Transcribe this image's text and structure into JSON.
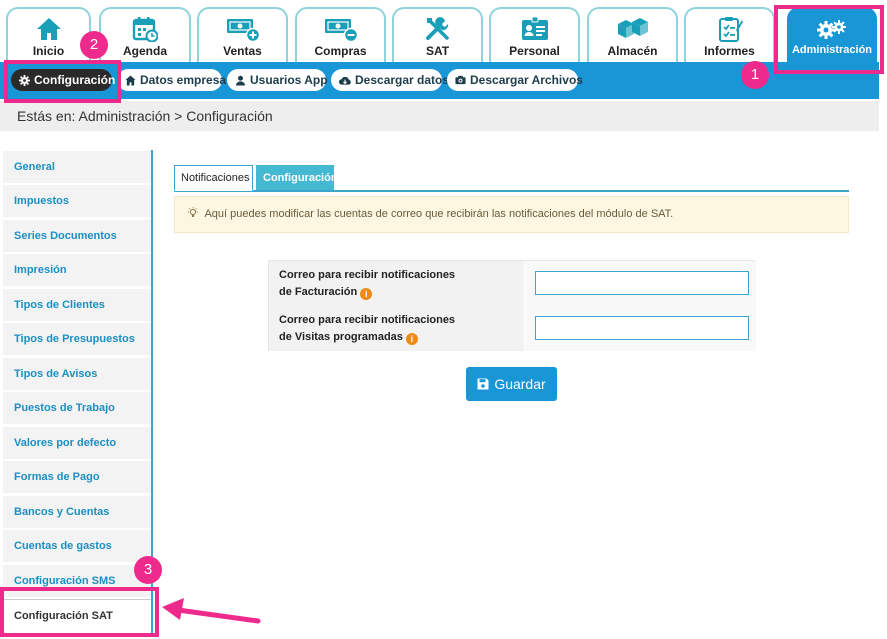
{
  "top_tabs": [
    {
      "label": "Inicio",
      "icon": "home-icon"
    },
    {
      "label": "Agenda",
      "icon": "calendar-icon"
    },
    {
      "label": "Ventas",
      "icon": "money-plus-icon"
    },
    {
      "label": "Compras",
      "icon": "money-minus-icon"
    },
    {
      "label": "SAT",
      "icon": "tools-icon"
    },
    {
      "label": "Personal",
      "icon": "id-card-icon"
    },
    {
      "label": "Almacén",
      "icon": "boxes-icon"
    },
    {
      "label": "Informes",
      "icon": "clipboard-icon"
    },
    {
      "label": "Administración",
      "icon": "gears-icon"
    }
  ],
  "sub_nav": [
    {
      "label": "Configuración",
      "icon": "gear-icon"
    },
    {
      "label": "Datos empresa",
      "icon": "home-icon"
    },
    {
      "label": "Usuarios App",
      "icon": "user-icon"
    },
    {
      "label": "Descargar datos",
      "icon": "cloud-download-icon"
    },
    {
      "label": "Descargar Archivos",
      "icon": "camera-icon"
    }
  ],
  "breadcrumb": "Estás en: Administración > Configuración",
  "sidebar": [
    "General",
    "Impuestos",
    "Series Documentos",
    "Impresión",
    "Tipos de Clientes",
    "Tipos de Presupuestos",
    "Tipos de Avisos",
    "Puestos de Trabajo",
    "Valores por defecto",
    "Formas de Pago",
    "Bancos y Cuentas",
    "Cuentas de gastos",
    "Configuración SMS",
    "Configuración SAT"
  ],
  "content_tabs": [
    "Notificaciones",
    "Configuración"
  ],
  "notice": "Aquí puedes modificar las cuentas de correo que recibirán las notificaciones del módulo de SAT.",
  "form": {
    "rows": [
      {
        "line1": "Correo para recibir notificaciones",
        "line2": "de Facturación",
        "value": ""
      },
      {
        "line1": "Correo para recibir notificaciones",
        "line2": "de Visitas programadas",
        "value": ""
      }
    ],
    "info_glyph": "i"
  },
  "save_label": "Guardar",
  "annotations": [
    "1",
    "2",
    "3"
  ],
  "colors": {
    "primary": "#1996d6",
    "highlight": "#ee2b8c",
    "warning": "#f08a17",
    "notice_bg": "#fdf7e2"
  }
}
